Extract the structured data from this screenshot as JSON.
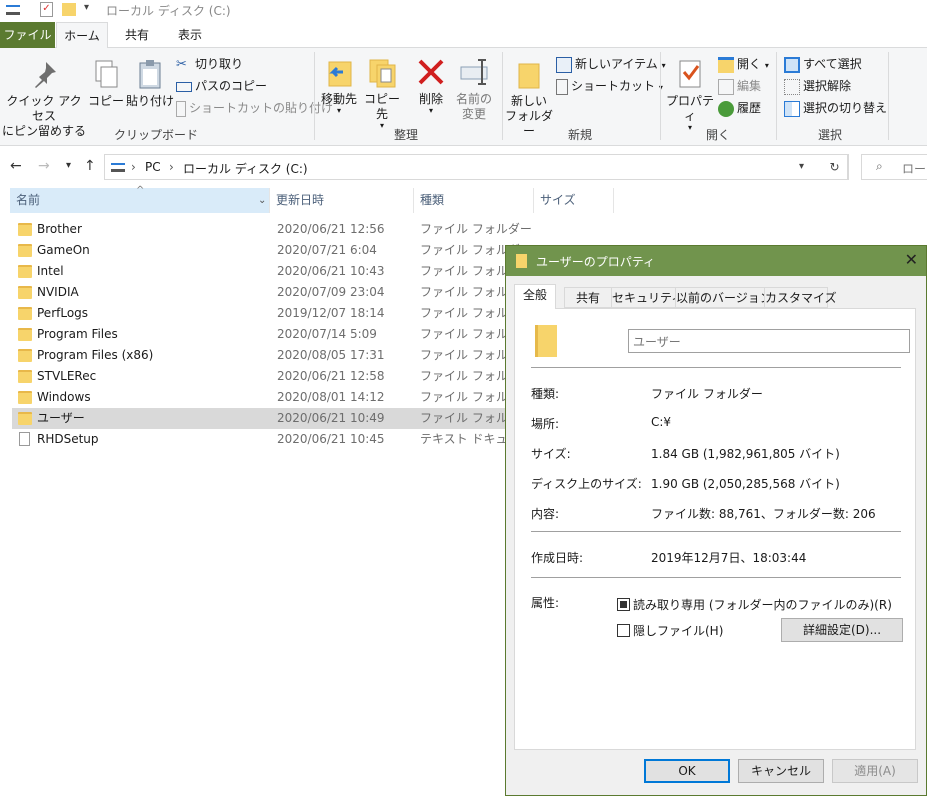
{
  "window": {
    "title": "ローカル ディスク (C:)"
  },
  "ribbon_tabs": [
    "ファイル",
    "ホーム",
    "共有",
    "表示"
  ],
  "ribbon": {
    "clipboard": {
      "pin_label": "クイック アクセス\nにピン留めする",
      "copy_label": "コピー",
      "paste_label": "貼り付け",
      "cut_label": "切り取り",
      "copy_path_label": "パスのコピー",
      "paste_shortcut_label": "ショートカットの貼り付け",
      "group_label": "クリップボード"
    },
    "organize": {
      "move_to_label": "移動先",
      "copy_to_label": "コピー先",
      "delete_label": "削除",
      "rename_label": "名前の\n変更",
      "group_label": "整理"
    },
    "new": {
      "new_folder_label": "新しい\nフォルダー",
      "new_item_label": "新しいアイテム",
      "shortcut_label": "ショートカット",
      "group_label": "新規"
    },
    "open": {
      "properties_label": "プロパティ",
      "open_label": "開く",
      "edit_label": "編集",
      "history_label": "履歴",
      "group_label": "開く"
    },
    "select": {
      "select_all_label": "すべて選択",
      "select_none_label": "選択解除",
      "invert_label": "選択の切り替え",
      "group_label": "選択"
    }
  },
  "address": {
    "crumbs": [
      "PC",
      "ローカル ディスク (C:)"
    ],
    "search_placeholder": "ローカ"
  },
  "columns": [
    "名前",
    "更新日時",
    "種類",
    "サイズ"
  ],
  "files": [
    {
      "name": "Brother",
      "date": "2020/06/21 12:56",
      "type": "ファイル フォルダー",
      "kind": "folder"
    },
    {
      "name": "GameOn",
      "date": "2020/07/21 6:04",
      "type": "ファイル フォルダー",
      "kind": "folder"
    },
    {
      "name": "Intel",
      "date": "2020/06/21 10:43",
      "type": "ファイル フォルダー",
      "kind": "folder"
    },
    {
      "name": "NVIDIA",
      "date": "2020/07/09 23:04",
      "type": "ファイル フォルダー",
      "kind": "folder"
    },
    {
      "name": "PerfLogs",
      "date": "2019/12/07 18:14",
      "type": "ファイル フォルダー",
      "kind": "folder"
    },
    {
      "name": "Program Files",
      "date": "2020/07/14 5:09",
      "type": "ファイル フォルダー",
      "kind": "folder"
    },
    {
      "name": "Program Files (x86)",
      "date": "2020/08/05 17:31",
      "type": "ファイル フォルダー",
      "kind": "folder"
    },
    {
      "name": "STVLERec",
      "date": "2020/06/21 12:58",
      "type": "ファイル フォルダー",
      "kind": "folder"
    },
    {
      "name": "Windows",
      "date": "2020/08/01 14:12",
      "type": "ファイル フォルダー",
      "kind": "folder"
    },
    {
      "name": "ユーザー",
      "date": "2020/06/21 10:49",
      "type": "ファイル フォルダー",
      "kind": "folder",
      "selected": true
    },
    {
      "name": "RHDSetup",
      "date": "2020/06/21 10:45",
      "type": "テキスト ドキュメント",
      "kind": "doc"
    }
  ],
  "dialog": {
    "title": "ユーザーのプロパティ",
    "tabs": [
      "全般",
      "共有",
      "セキュリティ",
      "以前のバージョン",
      "カスタマイズ"
    ],
    "name_value": "ユーザー",
    "props": [
      {
        "label": "種類:",
        "value": "ファイル フォルダー"
      },
      {
        "label": "場所:",
        "value": "C:¥"
      },
      {
        "label": "サイズ:",
        "value": "1.84 GB (1,982,961,805 バイト)"
      },
      {
        "label": "ディスク上のサイズ:",
        "value": "1.90 GB (2,050,285,568 バイト)"
      },
      {
        "label": "内容:",
        "value": "ファイル数: 88,761、フォルダー数: 206"
      }
    ],
    "created_label": "作成日時:",
    "created_value": "2019年12月7日、18:03:44",
    "attr_label": "属性:",
    "readonly_label": "読み取り専用 (フォルダー内のファイルのみ)(R)",
    "hidden_label": "隠しファイル(H)",
    "advanced_label": "詳細設定(D)...",
    "ok_label": "OK",
    "cancel_label": "キャンセル",
    "apply_label": "適用(A)"
  },
  "colors": {
    "file_tab": "#5b7a30",
    "dialog_title": "#71944d",
    "selection": "#d9d9d9",
    "sort_header": "#d9ebf9"
  }
}
